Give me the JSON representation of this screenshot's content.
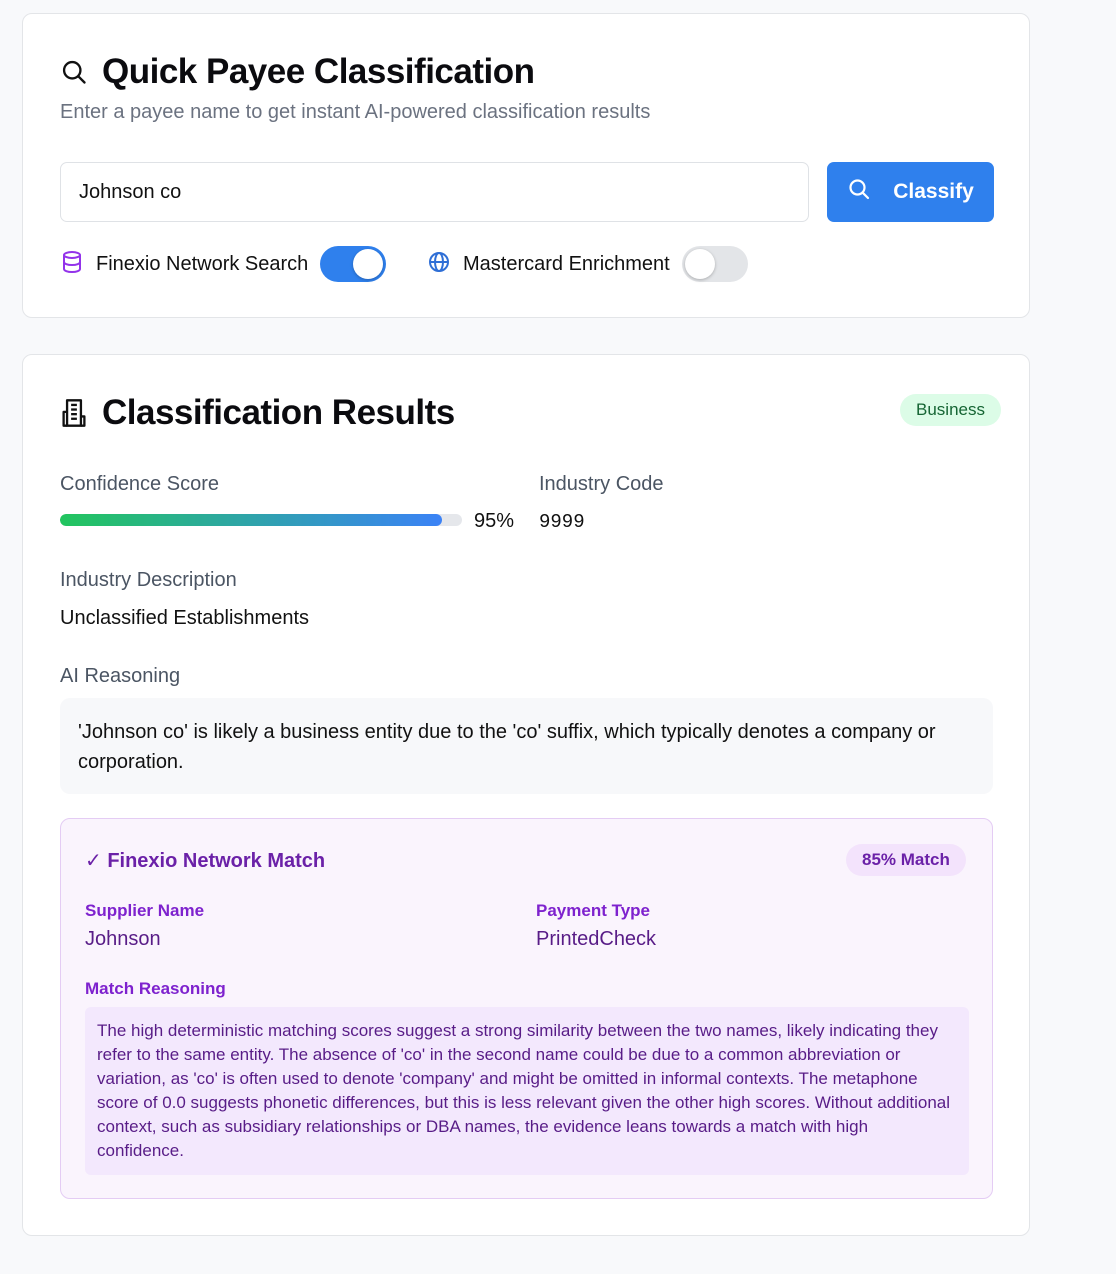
{
  "quick": {
    "title": "Quick Payee Classification",
    "subtitle": "Enter a payee name to get instant AI-powered classification results",
    "input_value": "Johnson co",
    "classify_label": "Classify",
    "finexio_label": "Finexio Network Search",
    "finexio_on": true,
    "mastercard_label": "Mastercard Enrichment",
    "mastercard_on": false
  },
  "results": {
    "title": "Classification Results",
    "badge": "Business",
    "confidence_label": "Confidence Score",
    "confidence_value": 0.95,
    "confidence_text": "95%",
    "industry_code_label": "Industry Code",
    "industry_code": "9999",
    "industry_desc_label": "Industry Description",
    "industry_desc": "Unclassified Establishments",
    "ai_reasoning_label": "AI Reasoning",
    "ai_reasoning": "'Johnson co' is likely a business entity due to the 'co' suffix, which typically denotes a company or corporation."
  },
  "match": {
    "title": "✓ Finexio Network Match",
    "badge": "85% Match",
    "supplier_label": "Supplier Name",
    "supplier_value": "Johnson",
    "payment_label": "Payment Type",
    "payment_value": "PrintedCheck",
    "reasoning_label": "Match Reasoning",
    "reasoning": "The high deterministic matching scores suggest a strong similarity between the two names, likely indicating they refer to the same entity. The absence of 'co' in the second name could be due to a common abbreviation or variation, as 'co' is often used to denote 'company' and might be omitted in informal contexts. The metaphone score of 0.0 suggests phonetic differences, but this is less relevant given the other high scores. Without additional context, such as subsidiary relationships or DBA names, the evidence leans towards a match with high confidence."
  },
  "colors": {
    "accent": "#2f80ed",
    "business_badge_bg": "#dcfce7",
    "match_accent": "#6b21a8"
  }
}
